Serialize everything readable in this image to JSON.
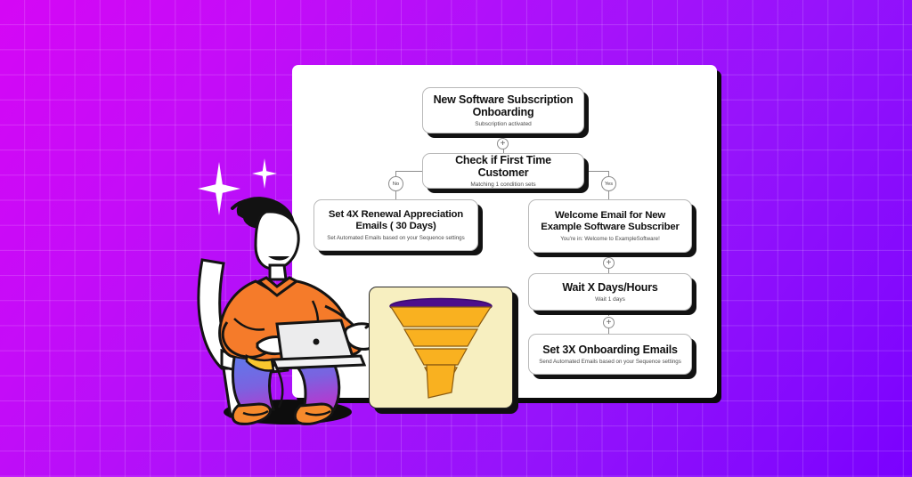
{
  "meta": {
    "scene_title": "Email onboarding automation workflow illustration",
    "background": {
      "gradient_from": "#d507f5",
      "gradient_to": "#7a00ff",
      "grid_line_color": "#ffffff"
    },
    "panel_color": "#ffffff",
    "shadow_color": "#101010"
  },
  "flow": {
    "nodes": [
      {
        "id": "start",
        "title": "New Software Subscription Onboarding",
        "subtitle": "Subscription activated"
      },
      {
        "id": "condition",
        "title": "Check if First Time Customer",
        "subtitle": "Matching 1 condition sets"
      },
      {
        "id": "renewal",
        "title": "Set 4X Renewal Appreciation Emails ( 30 Days)",
        "subtitle": "Set Automated Emails based on your Sequence settings"
      },
      {
        "id": "welcome",
        "title": "Welcome Email for New Example Software Subscriber",
        "subtitle": "You're in: Welcome to ExampleSoftware!"
      },
      {
        "id": "wait",
        "title": "Wait X Days/Hours",
        "subtitle": "Wait 1 days"
      },
      {
        "id": "onboarding",
        "title": "Set 3X Onboarding Emails",
        "subtitle": "Send Automated Emails based on your Sequence settings"
      }
    ],
    "branch_labels": {
      "no": "No",
      "yes": "Yes"
    },
    "add_step_glyph": "+"
  },
  "illustration": {
    "funnel": {
      "card_color": "#f7efc0",
      "rim_color": "#4d0f8c",
      "body_color": "#f9b120",
      "segments": 5
    },
    "person": {
      "shirt_color": "#f57b2a",
      "pants_gradient_from": "#5f79ea",
      "pants_gradient_to": "#a23fd6",
      "hair_color": "#141414",
      "chair_color": "#ffffff",
      "laptop_color": "#e9e9ec",
      "shoe_color": "#f68a2c"
    },
    "sparkles": 2
  }
}
